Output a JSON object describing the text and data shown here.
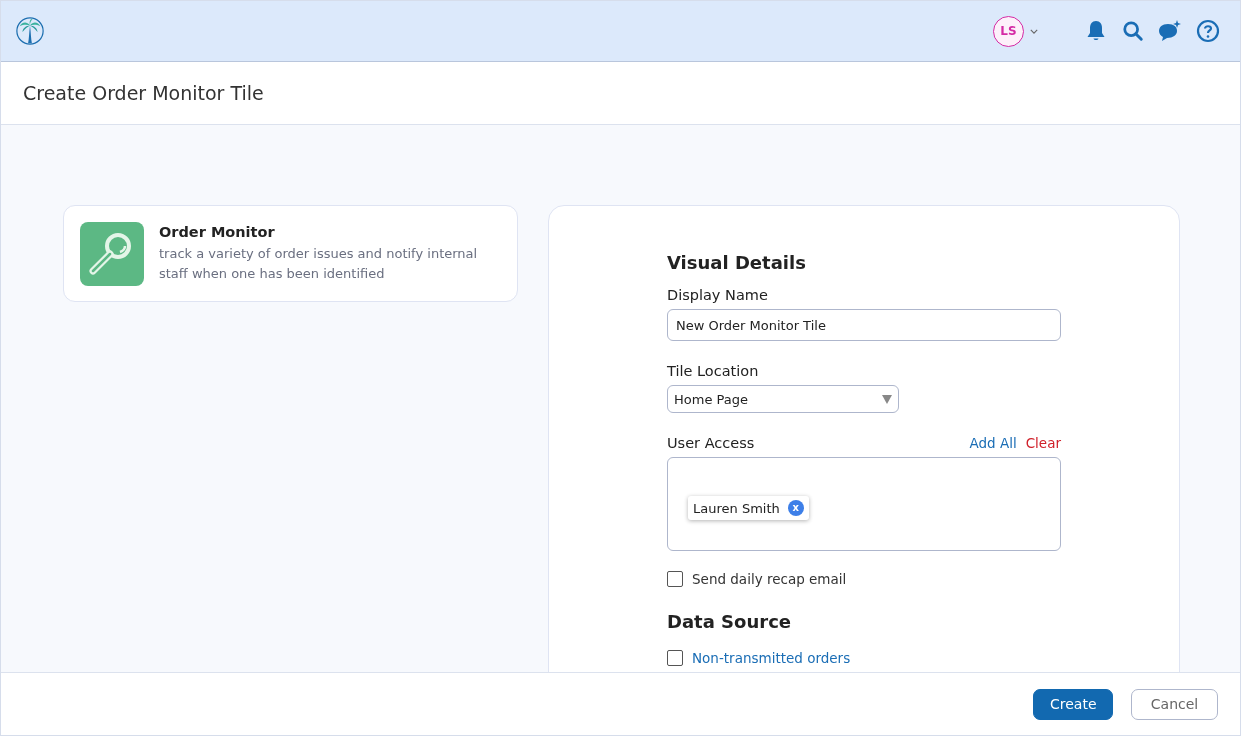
{
  "header": {
    "avatar": {
      "initials": "LS"
    }
  },
  "page": {
    "title": "Create Order Monitor Tile"
  },
  "tile_card": {
    "title": "Order Monitor",
    "description": "track a variety of order issues and notify internal staff when one has been identified"
  },
  "visual_details": {
    "heading": "Visual Details",
    "display_name": {
      "label": "Display Name",
      "value": "New Order Monitor Tile"
    },
    "tile_location": {
      "label": "Tile Location",
      "value": "Home Page"
    },
    "user_access": {
      "label": "User Access",
      "add_all": "Add All",
      "clear": "Clear",
      "users": [
        {
          "name": "Lauren Smith",
          "remove": "x"
        }
      ]
    },
    "recap": {
      "label": "Send daily recap email",
      "checked": false
    }
  },
  "data_source": {
    "heading": "Data Source",
    "options": [
      {
        "label": "Non-transmitted orders",
        "checked": false
      }
    ]
  },
  "footer": {
    "buttons": [
      {
        "label": "Create",
        "kind": "primary"
      },
      {
        "label": "Cancel",
        "kind": "secondary"
      }
    ]
  }
}
